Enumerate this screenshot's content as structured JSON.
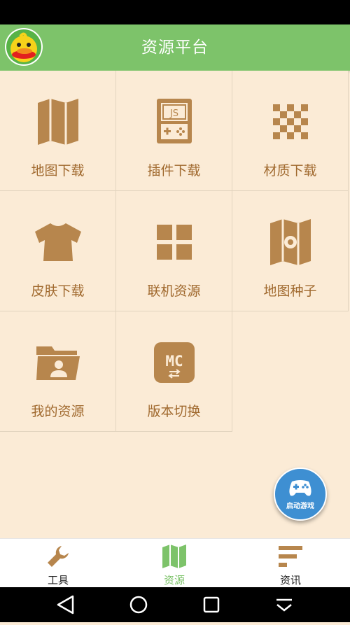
{
  "app": {
    "title": "资源平台"
  },
  "grid": {
    "items": [
      {
        "label": "地图下载",
        "icon": "map-icon"
      },
      {
        "label": "插件下载",
        "icon": "js-gameboy-icon"
      },
      {
        "label": "材质下载",
        "icon": "checker-texture-icon"
      },
      {
        "label": "皮肤下载",
        "icon": "shirt-icon"
      },
      {
        "label": "联机资源",
        "icon": "four-squares-icon"
      },
      {
        "label": "地图种子",
        "icon": "map-seed-icon"
      },
      {
        "label": "我的资源",
        "icon": "folder-user-icon"
      },
      {
        "label": "版本切换",
        "icon": "mc-switch-icon"
      }
    ]
  },
  "fab": {
    "label": "启动游戏",
    "icon": "gamepad-icon"
  },
  "bottom_nav": {
    "items": [
      {
        "label": "工具",
        "icon": "wrench-icon"
      },
      {
        "label": "资源",
        "icon": "map-icon",
        "active": true
      },
      {
        "label": "资讯",
        "icon": "news-lines-icon"
      }
    ]
  },
  "colors": {
    "accent": "#7dc36a",
    "icon_brown": "#b7864d",
    "background": "#fbebd6",
    "fab_blue": "#3e8fd2"
  }
}
